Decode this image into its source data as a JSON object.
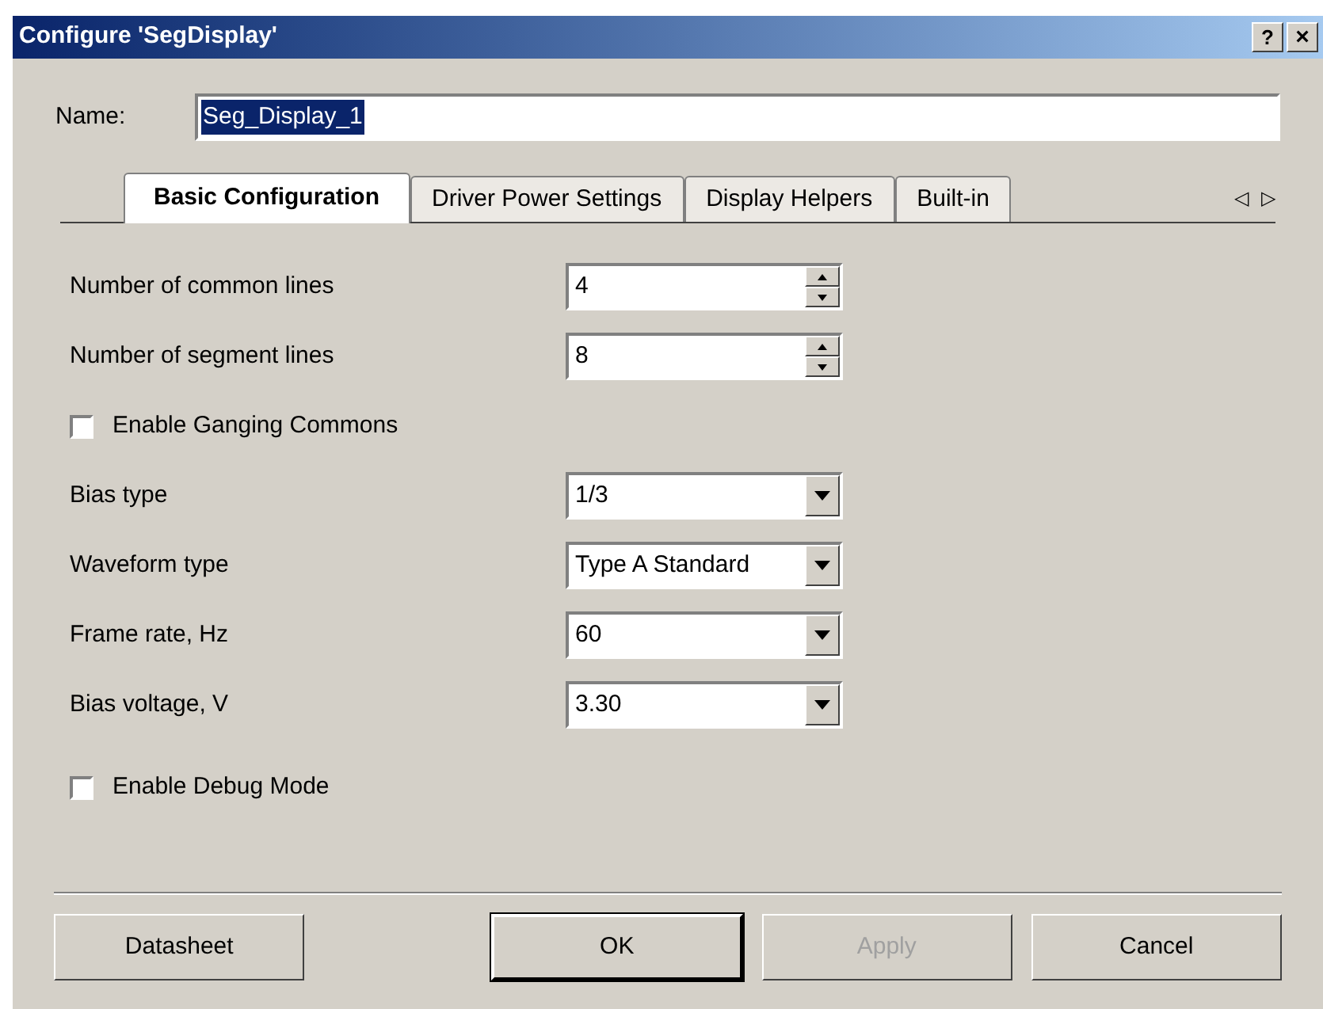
{
  "window": {
    "title": "Configure 'SegDisplay'",
    "help_button": "?",
    "close_button": "×"
  },
  "name_field": {
    "label": "Name:",
    "value": "Seg_Display_1"
  },
  "tabs": [
    {
      "label": "Basic Configuration",
      "selected": true
    },
    {
      "label": "Driver Power Settings",
      "selected": false
    },
    {
      "label": "Display Helpers",
      "selected": false
    },
    {
      "label": "Built-in",
      "selected": false
    }
  ],
  "tab_scroll": {
    "left": "◁",
    "right": "▷"
  },
  "settings": [
    {
      "kind": "spinner",
      "label": "Number of common lines",
      "value": "4"
    },
    {
      "kind": "spinner",
      "label": "Number of segment lines",
      "value": "8"
    },
    {
      "kind": "checkbox",
      "label": "Enable Ganging Commons",
      "checked": false
    },
    {
      "kind": "dropdown",
      "label": "Bias type",
      "value": "1/3"
    },
    {
      "kind": "dropdown",
      "label": "Waveform type",
      "value": "Type A Standard"
    },
    {
      "kind": "dropdown",
      "label": "Frame rate, Hz",
      "value": "60"
    },
    {
      "kind": "dropdown",
      "label": "Bias voltage, V",
      "value": "3.30"
    },
    {
      "kind": "checkbox",
      "label": "Enable Debug Mode",
      "checked": false
    }
  ],
  "buttons": [
    {
      "label": "Datasheet",
      "disabled": false,
      "default": false
    },
    {
      "label": "OK",
      "disabled": false,
      "default": true
    },
    {
      "label": "Apply",
      "disabled": true,
      "default": false
    },
    {
      "label": "Cancel",
      "disabled": false,
      "default": false
    }
  ]
}
